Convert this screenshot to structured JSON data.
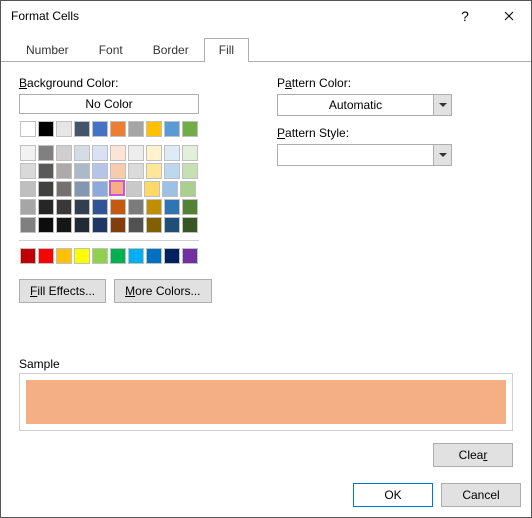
{
  "title": "Format Cells",
  "tabs": {
    "number": "Number",
    "font": "Font",
    "border": "Border",
    "fill": "Fill"
  },
  "bg_label": "Background Color:",
  "no_color": "No Color",
  "fill_effects": "Fill Effects...",
  "more_colors": "More Colors...",
  "pattern_color_label": "Pattern Color:",
  "pattern_color_value": "Automatic",
  "pattern_style_label": "Pattern Style:",
  "pattern_style_value": "",
  "sample_label": "Sample",
  "clear": "Clear",
  "ok": "OK",
  "cancel": "Cancel",
  "selected_color": "#f4b084",
  "palette_top": [
    [
      "#ffffff",
      "#000000",
      "#e7e6e6",
      "#44546a",
      "#4472c4",
      "#ed7d31",
      "#a5a5a5",
      "#ffc000",
      "#5b9bd5",
      "#70ad47"
    ]
  ],
  "palette_main": [
    [
      "#f2f2f2",
      "#808080",
      "#d0cece",
      "#d6dce4",
      "#d9e1f2",
      "#fce4d6",
      "#ededed",
      "#fff2cc",
      "#ddebf7",
      "#e2efda"
    ],
    [
      "#d9d9d9",
      "#595959",
      "#aeaaaa",
      "#acb9ca",
      "#b4c6e7",
      "#f8cbad",
      "#dbdbdb",
      "#ffe699",
      "#bdd7ee",
      "#c6e0b4"
    ],
    [
      "#bfbfbf",
      "#404040",
      "#757171",
      "#8497b0",
      "#8ea9db",
      "#f4b084",
      "#c9c9c9",
      "#ffd966",
      "#9bc2e6",
      "#a9d08e"
    ],
    [
      "#a6a6a6",
      "#262626",
      "#3a3838",
      "#333f4f",
      "#305496",
      "#c65911",
      "#7b7b7b",
      "#bf8f00",
      "#2f75b5",
      "#548235"
    ],
    [
      "#808080",
      "#0d0d0d",
      "#161616",
      "#222b35",
      "#203764",
      "#833c0c",
      "#525252",
      "#806000",
      "#1f4e78",
      "#375623"
    ]
  ],
  "palette_std": [
    [
      "#c00000",
      "#ff0000",
      "#ffc000",
      "#ffff00",
      "#92d050",
      "#00b050",
      "#00b0f0",
      "#0070c0",
      "#002060",
      "#7030a0"
    ]
  ]
}
